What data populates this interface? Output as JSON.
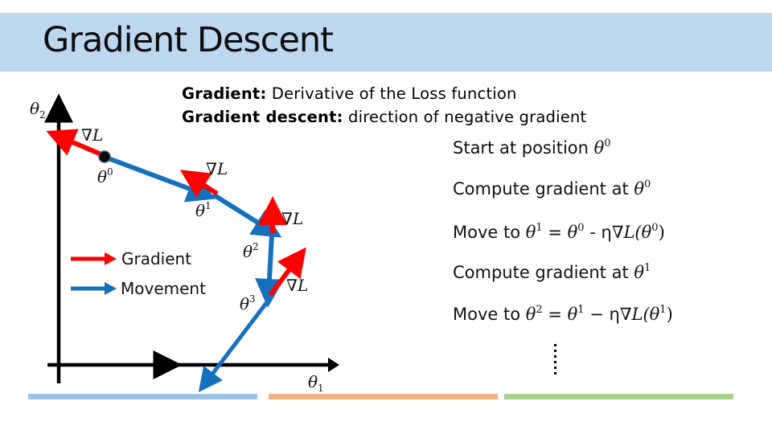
{
  "slide": {
    "title": "Gradient Descent",
    "definitions": [
      {
        "term": "Gradient:",
        "text": " Derivative of the Loss function"
      },
      {
        "term": "Gradient descent:",
        "text": " direction of negative gradient"
      }
    ],
    "steps": [
      {
        "text": "Start at position ",
        "math": "θ",
        "sup": "0",
        "rest": ""
      },
      {
        "text": "Compute gradient at ",
        "math": "θ",
        "sup": "0",
        "rest": ""
      },
      {
        "text": "Move to ",
        "math": "θ",
        "sup": "1",
        "rest_plain": " = ",
        "math2": "θ",
        "sup2": "0",
        "op": " - η",
        "grad": "∇L(θ",
        "sup3": "0",
        "close": ")"
      },
      {
        "text": "Compute gradient at ",
        "math": "θ",
        "sup": "1",
        "rest": ""
      },
      {
        "text": "Move to ",
        "math": "θ",
        "sup": "2",
        "rest_plain": " = ",
        "math2": "θ",
        "sup2": "1",
        "op": " − η",
        "grad": "∇L(θ",
        "sup3": "1",
        "close": ")"
      }
    ],
    "continuation": "vertical-ellipsis"
  },
  "diagram": {
    "axes": {
      "y_label": "θ",
      "y_sub": "2",
      "x_label": "θ",
      "x_sub": "1"
    },
    "points": [
      {
        "label": "θ",
        "sup": "0"
      },
      {
        "label": "θ",
        "sup": "1"
      },
      {
        "label": "θ",
        "sup": "2"
      },
      {
        "label": "θ",
        "sup": "3"
      }
    ],
    "gradient_label": "∇L",
    "legend": [
      {
        "name": "Gradient",
        "color": "#ff0000"
      },
      {
        "name": "Movement",
        "color": "#0f6fc0"
      }
    ]
  },
  "colors": {
    "title_bar": "#bdd7ee",
    "gradient": "#ff0000",
    "movement": "#1570be",
    "axis": "#000000",
    "footer_blue": "#9dc3e6",
    "footer_orange": "#f4b183",
    "footer_green": "#a9d18e"
  }
}
